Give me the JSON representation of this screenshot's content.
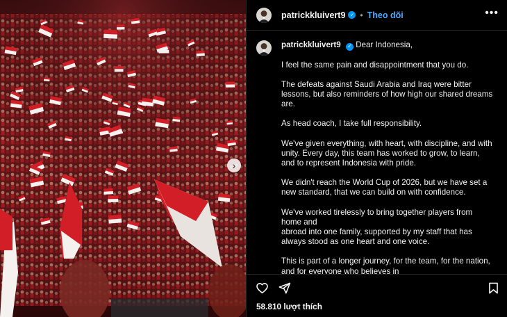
{
  "post": {
    "username": "patrickkluivert9",
    "follow_label": "Theo dõi",
    "separator": "•",
    "more_label": "•••",
    "verified_mark": "✓"
  },
  "caption": {
    "username": "patrickkluivert9",
    "greeting": "Dear Indonesia,",
    "paragraphs": [
      "I feel the same pain and disappointment that you do.",
      "The defeats against Saudi Arabia and Iraq were bitter lessons, but also reminders of how high our shared dreams are.",
      "As head coach, I take full responsibility.",
      "We've given everything, with heart, with discipline, and with unity. Every day, this team has worked to grow, to learn, and to represent Indonesia with pride.",
      "We didn't reach the World Cup of 2026, but we have set a new standard, that we can build on with confidence.",
      "We've worked tirelessly to bring together players from home and\nabroad into one family, supported by my staff that has always stood as one heart and one voice.",
      "This is part of a longer journey, for the team, for the nation, and for everyone who believes in\nIndonesian football."
    ]
  },
  "actions": {
    "like_icon": "heart-icon",
    "share_icon": "send-icon",
    "save_icon": "bookmark-icon"
  },
  "likes": {
    "text": "58.810 lượt thích"
  },
  "media": {
    "next_icon": "chevron-right-icon",
    "next_label": "›",
    "colors": {
      "red": "#d21f27",
      "white": "#f4f1ee",
      "crowd": "#5a1416"
    }
  }
}
